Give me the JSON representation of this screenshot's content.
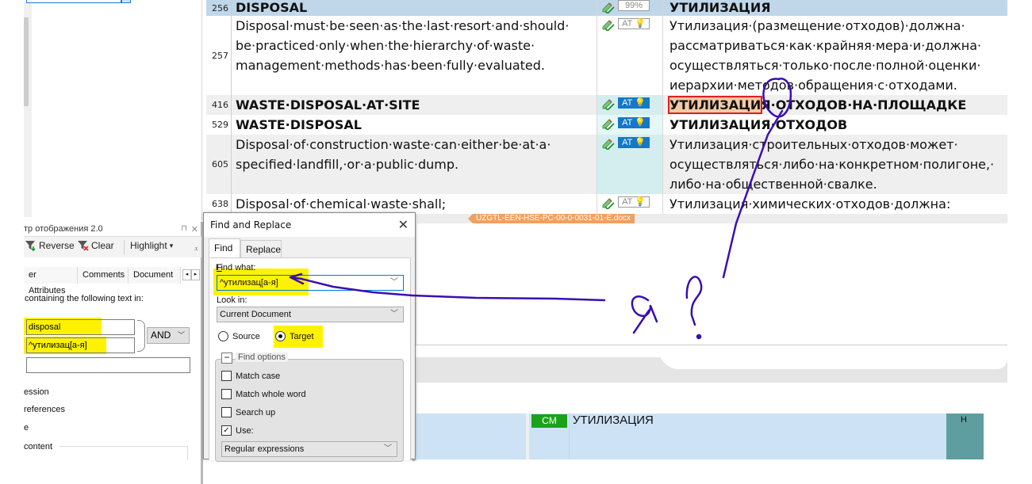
{
  "left_panel": {
    "title": "тр отображения 2.0",
    "pin_icon": "pin-icon",
    "close_icon": "close-icon",
    "toolbar": {
      "reverse_label": "Reverse",
      "clear_label": "Clear",
      "highlight_label": "Highlight",
      "highlight_caret": "▾",
      "overflow": "⩡"
    },
    "tabs": [
      "er Attributes",
      "Comments",
      "Document"
    ],
    "tab_prev": "◂",
    "tab_next": "▸",
    "containing_label": "containing the following text in:",
    "filter_source_value": "disposal",
    "filter_target_value": "^утилизац[а-я]",
    "filter_third_value": "",
    "operator_value": "AND",
    "options": [
      "ession",
      "references",
      "e"
    ],
    "content_group_label": "content"
  },
  "grid": {
    "rows": [
      {
        "num": "256",
        "source": "DISPOSAL",
        "source_bold": true,
        "status": "99%",
        "status_active": false,
        "target": "УТИЛИЗАЦИЯ",
        "target_bold": true
      },
      {
        "num": "257",
        "source": "Disposal·must·be·seen·as·the·last·resort·and·should· be·practiced·only·when·the·hierarchy·of·waste· management·methods·has·been·fully·evaluated.",
        "source_bold": false,
        "status": "AT",
        "status_active": false,
        "target": "Утилизация·(размещение·отходов)·должна· рассматриваться·как·крайняя·мера·и·должна· осуществляться·только·после·полной·оценки· иерархии·методов·обращения·с·отходами.",
        "target_bold": false
      },
      {
        "num": "416",
        "source": "WASTE·DISPOSAL·AT·SITE",
        "source_bold": true,
        "status": "AT",
        "status_active": true,
        "target_match": "УТИЛИЗАЦИ",
        "target_rest": "Я·ОТХОДОВ·НА·ПЛОЩАДКЕ",
        "target_bold": true
      },
      {
        "num": "529",
        "source": "WASTE·DISPOSAL",
        "source_bold": true,
        "status": "AT",
        "status_active": true,
        "target": "УТИЛИЗАЦИЯ·ОТХОДОВ",
        "target_bold": true
      },
      {
        "num": "605",
        "source": "Disposal·of·construction·waste·can·either·be·at·a· specified·landfill,·or·a·public·dump.",
        "source_bold": false,
        "status": "AT",
        "status_active": true,
        "target": "Утилизация·строительных·отходов·может· осуществляться·либо·на·конкретном·полигоне,· либо·на·общественной·свалке.",
        "target_bold": false
      },
      {
        "num": "638",
        "source": "Disposal·of·chemical·waste·shall;",
        "source_bold": false,
        "status": "AT",
        "status_active": false,
        "target": "Утилизация·химических·отходов·должна:",
        "target_bold": false
      }
    ],
    "file_tag": "UZGTL-EEN-HSE-PC-00-0-0031-01-E.docx",
    "colors": {
      "selected_row": "#c0d7ea",
      "alt_row": "#efefef",
      "badge_active": "#1478c8",
      "match_highlight": "#f5c9a4",
      "match_border": "#e02020",
      "file_tag": "#f0a060"
    }
  },
  "bottom_panel": {
    "cm_badge": "CM",
    "text": "УТИЛИЗАЦИЯ",
    "side_label": "Н",
    "colors": {
      "row": "#cde3f5",
      "cm": "#1aa31a",
      "teal": "#5f9ea0"
    }
  },
  "find_dialog": {
    "title": "Find and Replace",
    "tabs": [
      "Find",
      "Replace"
    ],
    "find_what_label": "Find what:",
    "find_what_value": "^утилизац[а-я]",
    "look_in_label": "Look in:",
    "look_in_value": "Current Document",
    "radio_source": "Source",
    "radio_target": "Target",
    "selected_radio": "Target",
    "find_options_label": "Find options",
    "match_case": {
      "label": "Match case",
      "checked": false
    },
    "match_whole_word": {
      "label": "Match whole word",
      "checked": false
    },
    "search_up": {
      "label": "Search up",
      "checked": false
    },
    "use": {
      "label": "Use:",
      "checked": true
    },
    "use_value": "Regular expressions"
  },
  "annotation": {
    "handwritten_text": "я ?",
    "pen_color": "#3a0fb0",
    "highlight_color": "#fff200"
  }
}
